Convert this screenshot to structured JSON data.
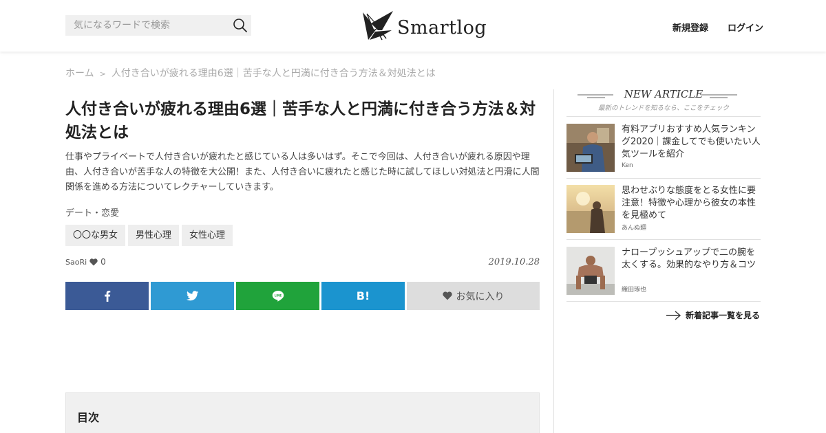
{
  "header": {
    "search_placeholder": "気になるワードで検索",
    "logo_text": "Smartlog",
    "signup": "新規登録",
    "login": "ログイン"
  },
  "breadcrumb": {
    "home": "ホーム",
    "separator": ">",
    "current": "人付き合いが疲れる理由6選｜苦手な人と円満に付き合う方法＆対処法とは"
  },
  "article": {
    "title": "人付き合いが疲れる理由6選｜苦手な人と円満に付き合う方法＆対処法とは",
    "lead": "仕事やプライベートで人付き合いが疲れたと感じている人は多いはず。そこで今回は、人付き合いが疲れる原因や理由、人付き合いが苦手な人の特徴を大公開！また、人付き合いに疲れたと感じた時に試してほしい対処法と円滑に人間関係を進める方法についてレクチャーしていきます。",
    "category": "デート・恋愛",
    "tags": [
      "〇〇な男女",
      "男性心理",
      "女性心理"
    ],
    "author": "SaoRi",
    "likes": "0",
    "date": "2019.10.28",
    "share": {
      "hatena": "B!",
      "favorite": "お気に入り"
    },
    "toc_title": "目次"
  },
  "sidebar": {
    "heading": "NEW ARTICLE",
    "subheading": "最新のトレンドを知るなら、ここをチェック",
    "items": [
      {
        "title": "有料アプリおすすめ人気ランキング2020｜課金してでも使いたい人気ツールを紹介",
        "author": "Ken"
      },
      {
        "title": "思わせぶりな態度をとる女性に要注意！特徴や心理から彼女の本性を見極めて",
        "author": "あんぬ廻"
      },
      {
        "title": "ナロープッシュアップで二の腕を太くする。効果的なやり方＆コツ",
        "author": "織田琢也"
      }
    ],
    "more": "新着記事一覧を見る"
  },
  "colors": {
    "facebook": "#3b5a96",
    "twitter": "#2f9ad3",
    "line": "#20a33b",
    "hatena": "#1b94cf",
    "favorite": "#dddddd"
  }
}
